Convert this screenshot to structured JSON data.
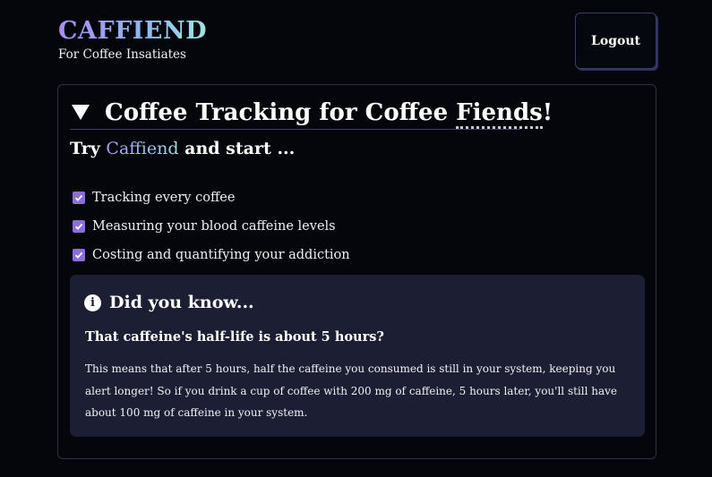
{
  "header": {
    "brand_title": "CAFFIEND",
    "brand_subtitle": "For Coffee Insatiates",
    "logout_label": "Logout"
  },
  "hero": {
    "summary_prefix": "Coffee Tracking for Coffee ",
    "summary_abbr": "Fiends",
    "summary_suffix": "!",
    "try_prefix": "Try ",
    "try_brand": "Caffiend",
    "try_suffix": " and start ...",
    "features": [
      "Tracking every coffee",
      "Measuring your blood caffeine levels",
      "Costing and quantifying your addiction"
    ]
  },
  "info": {
    "icon": "info-icon",
    "title": "Did you know...",
    "subtitle": "That caffeine's half-life is about 5 hours?",
    "body": "This means that after 5 hours, half the caffeine you consumed is still in your system, keeping you alert longer! So if you drink a cup of coffee with 200 mg of caffeine, 5 hours later, you'll still have about 100 mg of caffeine in your system."
  },
  "colors": {
    "background": "#04060c",
    "accent_purple": "#8a6fd6",
    "info_background": "#1c1f33"
  }
}
